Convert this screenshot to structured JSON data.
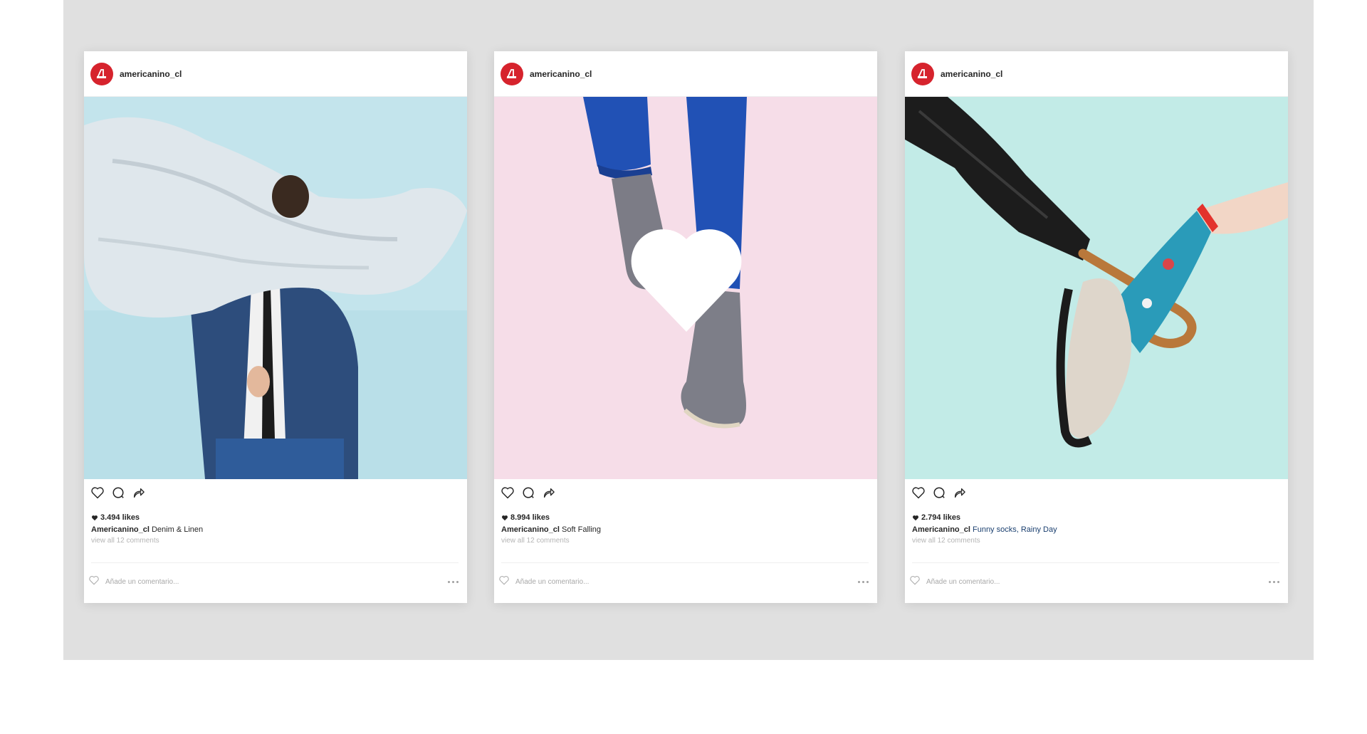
{
  "posts": [
    {
      "username": "americanino_cl",
      "likes": "3.494 likes",
      "caption_user": "Americanino_cl",
      "caption_text": "Denim & Linen",
      "caption_tags": [],
      "view_comments": "view all 12 comments",
      "comment_placeholder": "Añade un comentario...",
      "photo_background": "#bfe2ea",
      "photo_subject": "man in denim jacket with flying linen shirt"
    },
    {
      "username": "americanino_cl",
      "likes": "8.994 likes",
      "caption_user": "Americanino_cl",
      "caption_text": "Soft Falling",
      "caption_tags": [],
      "view_comments": "view all 12 comments",
      "comment_placeholder": "Añade un comentario...",
      "photo_background": "#f6dbe7",
      "photo_subject": "legs in blue jeans and grey suede boots with white heart"
    },
    {
      "username": "americanino_cl",
      "likes": "2.794 likes",
      "caption_user": "Americanino_cl",
      "caption_text": "",
      "caption_tags": [
        "Funny socks",
        ", ",
        "Rainy Day"
      ],
      "view_comments": "view all 12 comments",
      "comment_placeholder": "Añade un comentario...",
      "photo_background": "#bfe9e6",
      "photo_subject": "umbrella handle hooking a foot in patterned sock and platform slip-on"
    }
  ],
  "colors": {
    "stage": "#e0e0e0",
    "brand_red": "#d6232d",
    "tag_blue": "#1a3f6f"
  },
  "icons": [
    "heart-icon",
    "comment-icon",
    "share-icon",
    "heart-filled-icon",
    "more-icon"
  ]
}
